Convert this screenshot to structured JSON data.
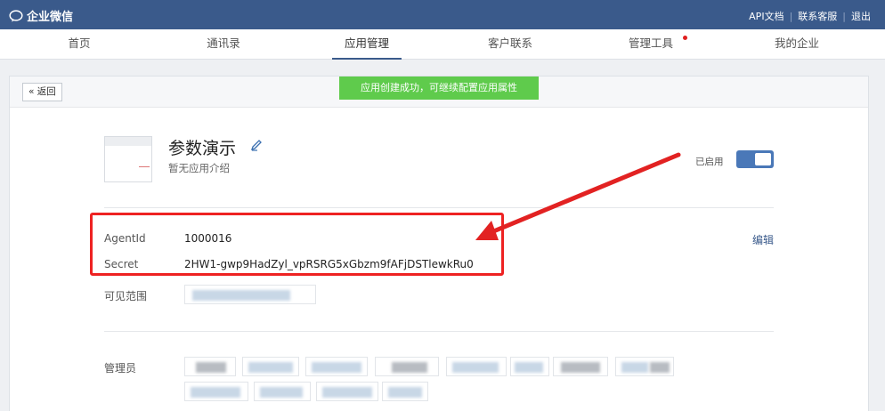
{
  "header": {
    "logo_text": "企业微信",
    "links": [
      "API文档",
      "联系客服",
      "退出"
    ]
  },
  "nav": {
    "items": [
      "首页",
      "通讯录",
      "应用管理",
      "客户联系",
      "管理工具",
      "我的企业"
    ],
    "active": "应用管理"
  },
  "panel": {
    "back_label": "返回",
    "toast": "应用创建成功，可继续配置应用属性"
  },
  "app": {
    "name": "参数演示",
    "description": "暂无应用介绍",
    "status_label": "已启用",
    "enabled": true
  },
  "fields": {
    "agentid_label": "AgentId",
    "agentid_value": "1000016",
    "secret_label": "Secret",
    "secret_value": "2HW1-gwp9HadZyl_vpRSRG5xGbzm9fAFjDSTlewkRu0",
    "edit_label": "编辑",
    "visible_range_label": "可见范围",
    "admins_label": "管理员"
  },
  "colors": {
    "topbar": "#3a5a8b",
    "toast": "#5fcb4c",
    "annotation": "#e22222",
    "toggle": "#4a78b8"
  }
}
